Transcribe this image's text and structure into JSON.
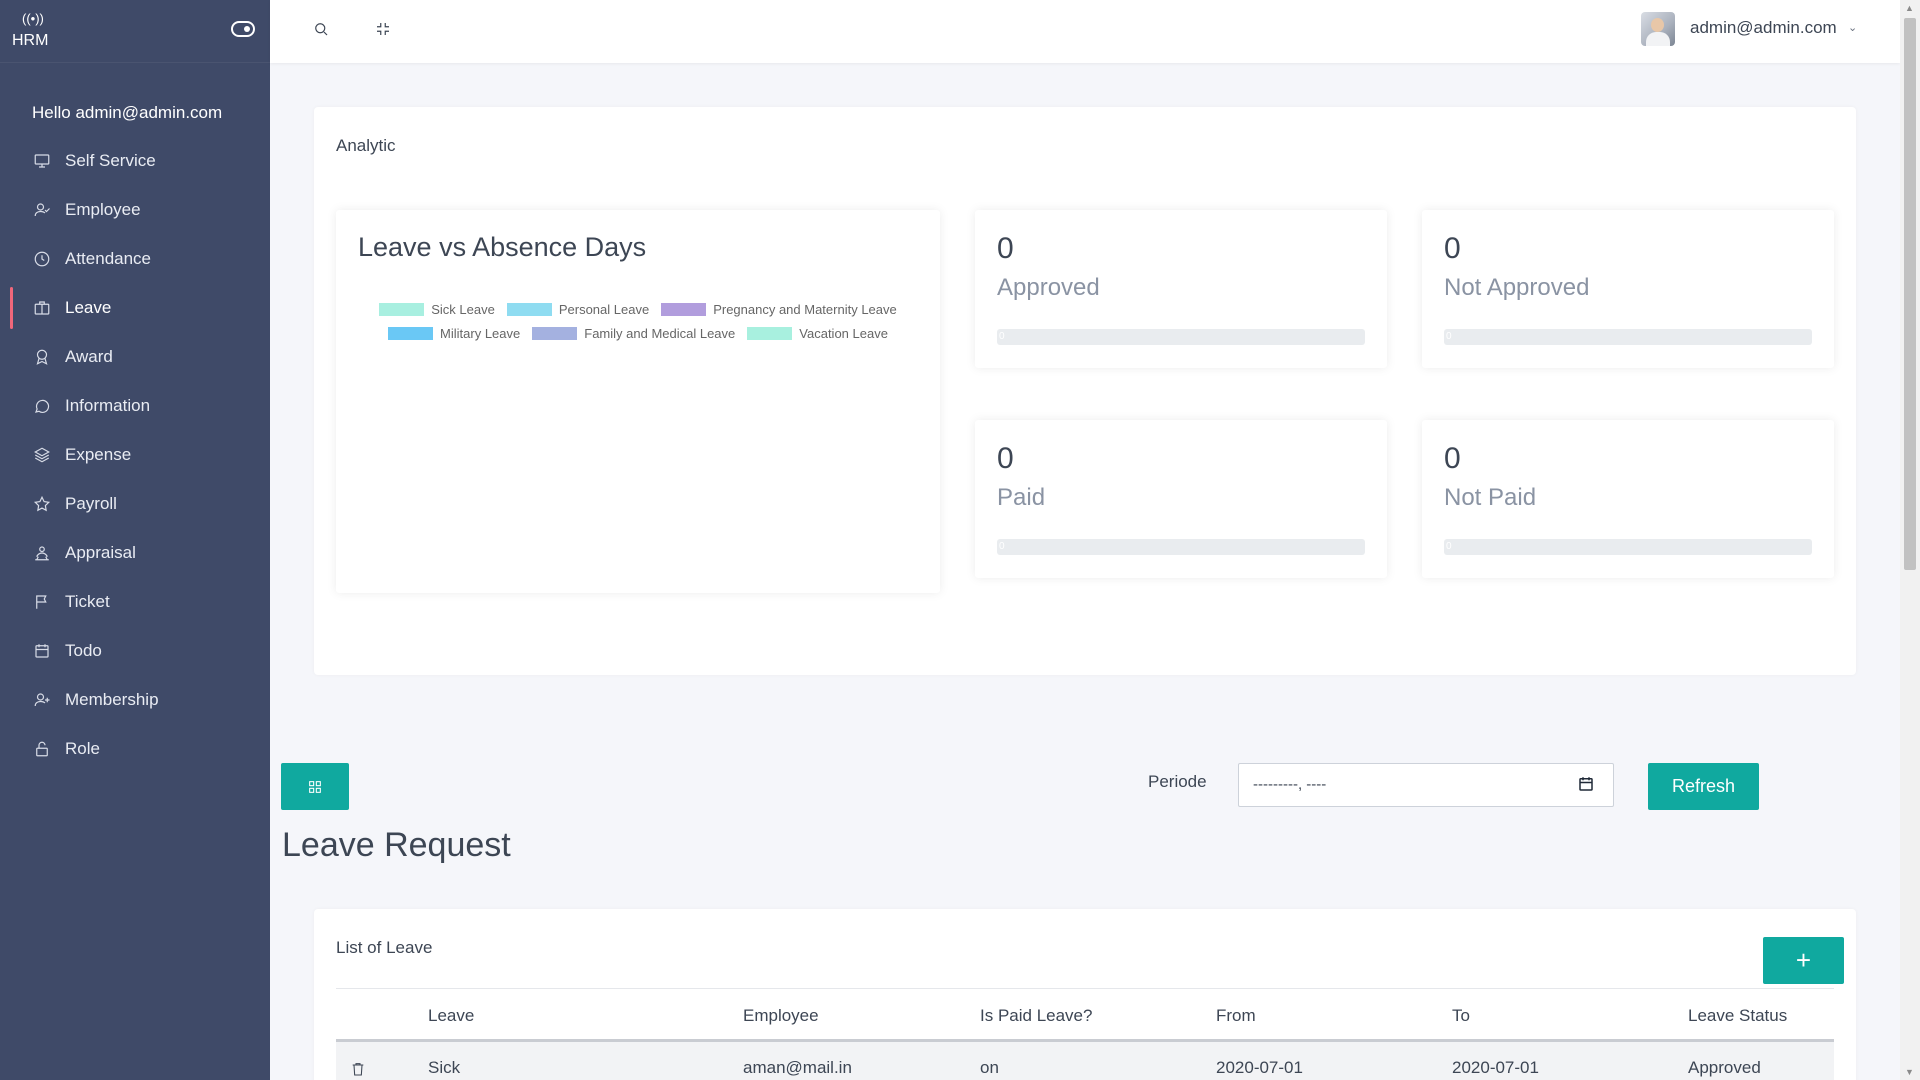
{
  "app": {
    "brand": "HRM"
  },
  "sidebar": {
    "greeting": "Hello admin@admin.com",
    "items": [
      {
        "label": "Self Service",
        "icon": "monitor-icon"
      },
      {
        "label": "Employee",
        "icon": "user-icon"
      },
      {
        "label": "Attendance",
        "icon": "clock-icon"
      },
      {
        "label": "Leave",
        "icon": "briefcase-icon",
        "active": true
      },
      {
        "label": "Award",
        "icon": "award-icon"
      },
      {
        "label": "Information",
        "icon": "chat-icon"
      },
      {
        "label": "Expense",
        "icon": "layers-icon"
      },
      {
        "label": "Payroll",
        "icon": "star-icon"
      },
      {
        "label": "Appraisal",
        "icon": "appraisal-icon"
      },
      {
        "label": "Ticket",
        "icon": "flag-icon"
      },
      {
        "label": "Todo",
        "icon": "calendar-icon"
      },
      {
        "label": "Membership",
        "icon": "user-plus-icon"
      },
      {
        "label": "Role",
        "icon": "lock-icon"
      }
    ]
  },
  "topbar": {
    "user_email": "admin@admin.com"
  },
  "analytic": {
    "title": "Analytic",
    "stats": [
      {
        "value": "0",
        "label": "Approved",
        "bar_text": "0",
        "progress": 0
      },
      {
        "value": "0",
        "label": "Not Approved",
        "bar_text": "0",
        "progress": 0
      },
      {
        "value": "0",
        "label": "Paid",
        "bar_text": "0",
        "progress": 0
      },
      {
        "value": "0",
        "label": "Not Paid",
        "bar_text": "0",
        "progress": 0
      }
    ]
  },
  "chart_data": {
    "type": "bar",
    "title": "Leave vs Absence Days",
    "categories": [],
    "series": [
      {
        "name": "Sick Leave",
        "color": "#a8efe0",
        "values": []
      },
      {
        "name": "Personal Leave",
        "color": "#8fdcf1",
        "values": []
      },
      {
        "name": "Pregnancy and Maternity Leave",
        "color": "#b19ddd",
        "values": []
      },
      {
        "name": "Military Leave",
        "color": "#6ac8f5",
        "values": []
      },
      {
        "name": "Family and Medical Leave",
        "color": "#a4b1e0",
        "values": []
      },
      {
        "name": "Vacation Leave",
        "color": "#a8f0df",
        "values": []
      }
    ],
    "legend": "top"
  },
  "toolbar": {
    "periode_label": "Periode",
    "periode_value": "---------, ----",
    "refresh_label": "Refresh",
    "add_label": "+"
  },
  "page": {
    "heading": "Leave Request"
  },
  "list": {
    "title": "List of Leave",
    "columns": [
      "Leave",
      "Employee",
      "Is Paid Leave?",
      "From",
      "To",
      "Leave Status"
    ],
    "rows": [
      [
        "Sick",
        "aman@mail.in",
        "on",
        "2020-07-01",
        "2020-07-01",
        "Approved"
      ]
    ]
  },
  "colors": {
    "accent": "#10a99f",
    "sidebar": "#3f4a68",
    "active_marker": "#f0677a"
  }
}
